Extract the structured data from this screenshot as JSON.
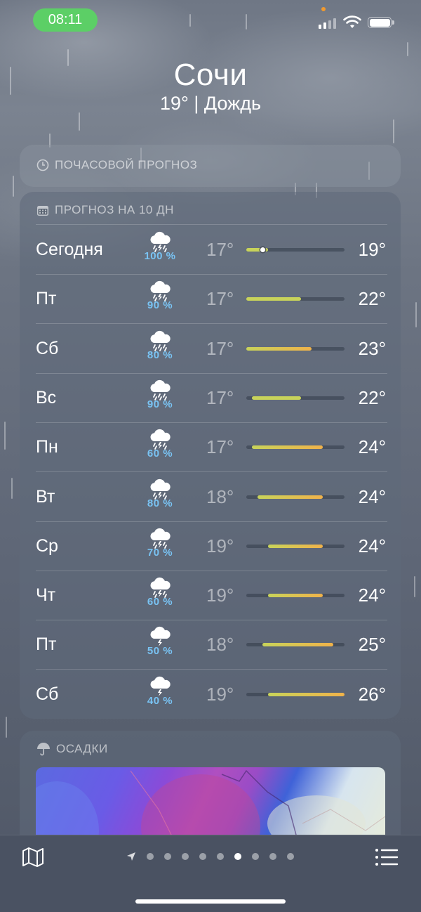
{
  "status_bar": {
    "time": "08:11"
  },
  "header": {
    "city": "Сочи",
    "condition": "19° | Дождь"
  },
  "hourly_card": {
    "title": "ПОЧАСОВОЙ ПРОГНОЗ"
  },
  "forecast": {
    "title": "ПРОГНОЗ НА 10 ДН",
    "range_min": 17,
    "range_max": 26,
    "days": [
      {
        "day": "Сегодня",
        "precip": "100 %",
        "icon": "cloud-lightning-rain-icon",
        "lo": "17°",
        "hi": "19°",
        "lo_val": 17,
        "hi_val": 19,
        "current": 18.5
      },
      {
        "day": "Пт",
        "precip": "90 %",
        "icon": "cloud-lightning-rain-icon",
        "lo": "17°",
        "hi": "22°",
        "lo_val": 17,
        "hi_val": 22
      },
      {
        "day": "Сб",
        "precip": "80 %",
        "icon": "cloud-rain-icon",
        "lo": "17°",
        "hi": "23°",
        "lo_val": 17,
        "hi_val": 23
      },
      {
        "day": "Вс",
        "precip": "90 %",
        "icon": "cloud-rain-icon",
        "lo": "17°",
        "hi": "22°",
        "lo_val": 17.5,
        "hi_val": 22
      },
      {
        "day": "Пн",
        "precip": "60 %",
        "icon": "cloud-lightning-rain-icon",
        "lo": "17°",
        "hi": "24°",
        "lo_val": 17.5,
        "hi_val": 24
      },
      {
        "day": "Вт",
        "precip": "80 %",
        "icon": "cloud-lightning-rain-icon",
        "lo": "18°",
        "hi": "24°",
        "lo_val": 18,
        "hi_val": 24
      },
      {
        "day": "Ср",
        "precip": "70 %",
        "icon": "cloud-lightning-rain-icon",
        "lo": "19°",
        "hi": "24°",
        "lo_val": 19,
        "hi_val": 24
      },
      {
        "day": "Чт",
        "precip": "60 %",
        "icon": "cloud-lightning-rain-icon",
        "lo": "19°",
        "hi": "24°",
        "lo_val": 19,
        "hi_val": 24
      },
      {
        "day": "Пт",
        "precip": "50 %",
        "icon": "cloud-lightning-icon",
        "lo": "18°",
        "hi": "25°",
        "lo_val": 18.5,
        "hi_val": 25
      },
      {
        "day": "Сб",
        "precip": "40 %",
        "icon": "cloud-lightning-icon",
        "lo": "19°",
        "hi": "26°",
        "lo_val": 19,
        "hi_val": 26
      }
    ]
  },
  "precip_card": {
    "title": "ОСАДКИ"
  },
  "pager": {
    "count": 9,
    "active_index": 5
  },
  "colors": {
    "bar_cool": "#c8d35a",
    "bar_warm": "#f0b24a",
    "precip_text": "#79c3f3",
    "status_pill": "#5ccf66"
  }
}
